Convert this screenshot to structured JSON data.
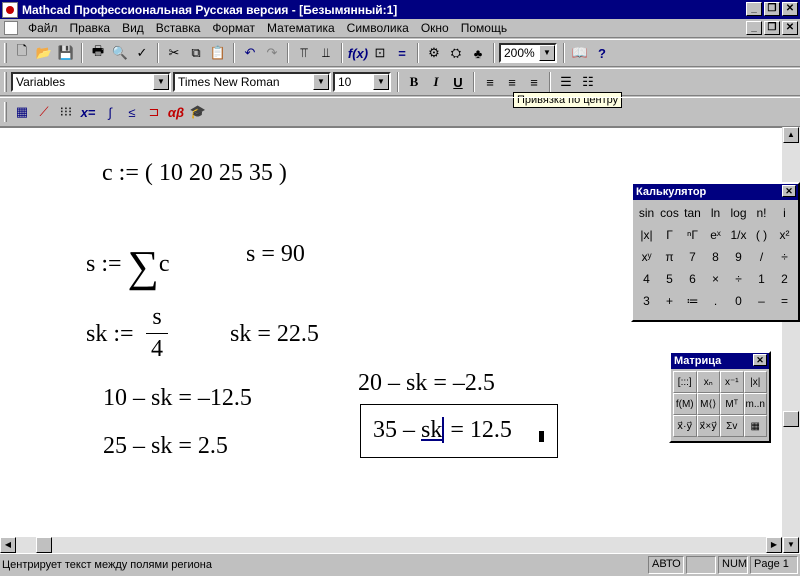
{
  "window": {
    "title": "Mathcad Профессиональная Русская версия - [Безымянный:1]"
  },
  "menu": [
    "Файл",
    "Правка",
    "Вид",
    "Вставка",
    "Формат",
    "Математика",
    "Символика",
    "Окно",
    "Помощь"
  ],
  "toolbar": {
    "zoom": "200%"
  },
  "format_bar": {
    "style": "Variables",
    "font": "Times New Roman",
    "size": "10"
  },
  "tooltip": "Привязка по центру",
  "math_bar": {
    "buttons": [
      "x=",
      "αβ"
    ]
  },
  "worksheet": {
    "line1": "c := ( 10   20   25   35 )",
    "s_def_left": "s :=",
    "s_def_right": "c",
    "sum_symbol": "∑",
    "s_result": "s = 90",
    "sk_def_left": "sk :=",
    "sk_num": "s",
    "sk_den": "4",
    "sk_result": "sk = 22.5",
    "eq1": "10 – sk = –12.5",
    "eq2": "25 – sk = 2.5",
    "eq3": "20 – sk = –2.5",
    "eq4_prefix": "35 – ",
    "eq4_var": "sk",
    "eq4_suffix": " = 12.5"
  },
  "calculator": {
    "title": "Калькулятор",
    "keys": [
      "sin",
      "cos",
      "tan",
      "ln",
      "log",
      "n!",
      "i",
      "|x|",
      "Γ",
      "ⁿΓ",
      "eˣ",
      "1/x",
      "( )",
      "x²",
      "xʸ",
      "π",
      "7",
      "8",
      "9",
      "/",
      "÷",
      "4",
      "5",
      "6",
      "×",
      "÷",
      "1",
      "2",
      "3",
      "+",
      "≔",
      ".",
      "0",
      "–",
      "="
    ]
  },
  "matrix": {
    "title": "Матрица",
    "keys": [
      "[:::]",
      "xₙ",
      "x⁻¹",
      "|x|",
      "f(M)",
      "M⟨⟩",
      "Mᵀ",
      "m..n",
      "x⃗·y⃗",
      "x⃗×y⃗",
      "Σv",
      "▦"
    ]
  },
  "status": {
    "hint": "Центрирует текст между полями региона",
    "mode": "АВТО",
    "num": "NUM",
    "page": "Page 1"
  }
}
